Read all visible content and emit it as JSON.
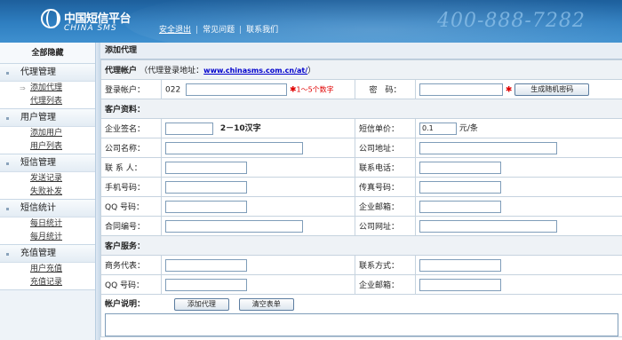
{
  "header": {
    "logo_cn": "中国短信平台",
    "logo_en": "CHINA SMS",
    "nav": [
      "安全退出",
      "常见问题",
      "联系我们"
    ],
    "phone": "400-888-7282"
  },
  "sidebar": {
    "toggle_label": "全部隐藏",
    "groups": [
      {
        "title": "代理管理",
        "items": [
          "添加代理",
          "代理列表"
        ]
      },
      {
        "title": "用户管理",
        "items": [
          "添加用户",
          "用户列表"
        ]
      },
      {
        "title": "短信管理",
        "items": [
          "发送记录",
          "失败补发"
        ]
      },
      {
        "title": "短信统计",
        "items": [
          "每日统计",
          "每月统计"
        ]
      },
      {
        "title": "充值管理",
        "items": [
          "用户充值",
          "充值记录"
        ]
      }
    ]
  },
  "main": {
    "title": "添加代理",
    "agent_section": {
      "label": "代理帐户",
      "url_prefix": "（代理登录地址：",
      "url": "www.chinasms.com.cn/at/",
      "url_suffix": "）"
    },
    "login": {
      "label": "登录帐户：",
      "prefix": "022",
      "value": "",
      "hint": "1～5个数字",
      "password_label": "密　码：",
      "password_value": "",
      "generate_button": "生成随机密码"
    },
    "customer_section": "客户资料：",
    "signature": {
      "label": "企业签名：",
      "value": "",
      "hint": "2－10汉字"
    },
    "unit_price": {
      "label": "短信单价：",
      "value": "0.1",
      "unit": "元/条"
    },
    "company_name": "公司名称：",
    "company_address": "公司地址：",
    "contact_person": "联 系 人：",
    "contact_phone": "联系电话：",
    "mobile": "手机号码：",
    "fax": "传真号码：",
    "qq": "QQ  号码：",
    "email": "企业邮箱：",
    "contract_no": "合同编号：",
    "website": "公司网址：",
    "service_section": "客户服务：",
    "sales_rep": "商务代表：",
    "contact_method": "联系方式：",
    "service_qq": "QQ  号码：",
    "service_email": "企业邮箱：",
    "account_note": "帐户说明：",
    "add_button": "添加代理",
    "clear_button": "清空表单"
  }
}
